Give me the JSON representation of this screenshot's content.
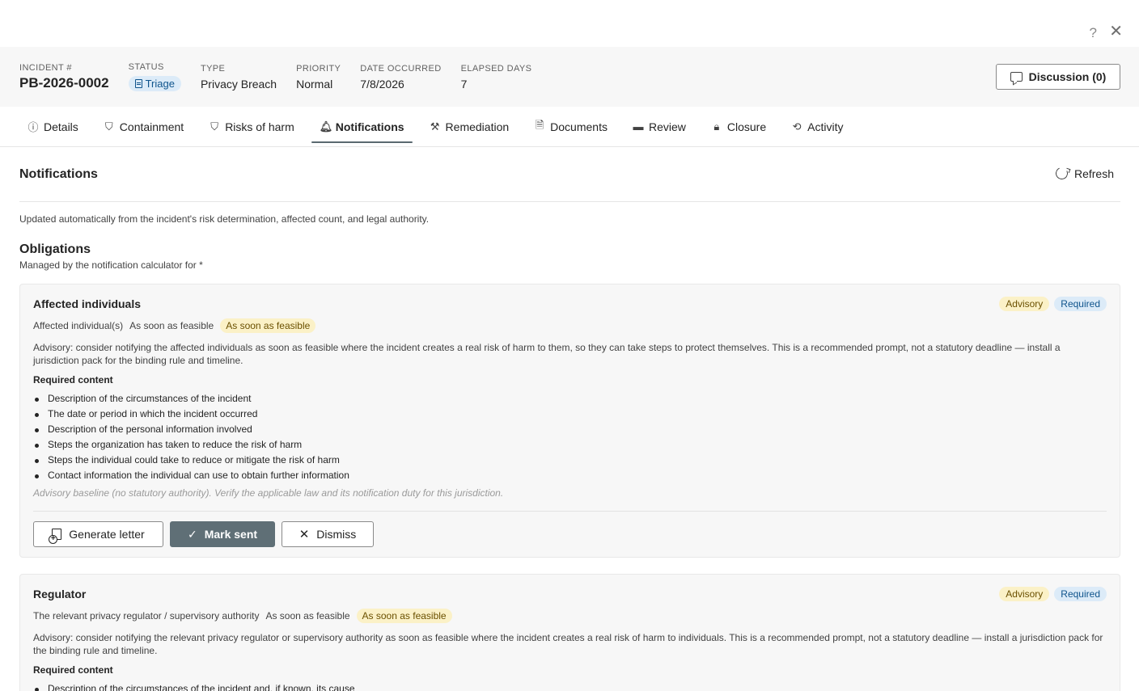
{
  "window": {
    "help_glyph": "?",
    "close_glyph": "✕"
  },
  "header": {
    "incident_label": "INCIDENT #",
    "incident_value": "PB-2026-0002",
    "status_label": "STATUS",
    "status_value": "Triage",
    "type_label": "TYPE",
    "type_value": "Privacy Breach",
    "priority_label": "PRIORITY",
    "priority_value": "Normal",
    "date_label": "DATE OCCURRED",
    "date_value": "7/8/2026",
    "elapsed_label": "ELAPSED DAYS",
    "elapsed_value": "7",
    "discussion_label": "Discussion (0)"
  },
  "tabs": [
    {
      "label": "Details",
      "icon": "info-icon",
      "glyph": "ⓘ"
    },
    {
      "label": "Containment",
      "icon": "shield-icon",
      "glyph": "⛉"
    },
    {
      "label": "Risks of harm",
      "icon": "shield-outline-icon",
      "glyph": "⛉"
    },
    {
      "label": "Notifications",
      "icon": "bell-icon",
      "glyph": "🔔︎",
      "active": true
    },
    {
      "label": "Remediation",
      "icon": "tools-icon",
      "glyph": "⚒"
    },
    {
      "label": "Documents",
      "icon": "document-icon",
      "glyph": "🗎"
    },
    {
      "label": "Review",
      "icon": "chat-icon",
      "glyph": "▬"
    },
    {
      "label": "Closure",
      "icon": "lock-icon",
      "glyph": "🔒︎"
    },
    {
      "label": "Activity",
      "icon": "history-icon",
      "glyph": "⟲"
    }
  ],
  "section": {
    "title": "Notifications",
    "refresh_label": "Refresh",
    "helper_text": "Updated automatically from the incident's risk determination, affected count, and legal authority.",
    "obligations_title": "Obligations",
    "obligations_subtitle": "Managed by the notification calculator for *"
  },
  "cards": [
    {
      "title": "Affected individuals",
      "badge_advisory": "Advisory",
      "badge_required": "Required",
      "recipient": "Affected individual(s)",
      "timing": "As soon as feasible",
      "timing_pill": "As soon as feasible",
      "description": "Advisory: consider notifying the affected individuals as soon as feasible where the incident creates a real risk of harm to them, so they can take steps to protect themselves. This is a recommended prompt, not a statutory deadline — install a jurisdiction pack for the binding rule and timeline.",
      "required_title": "Required content",
      "required_items": [
        "Description of the circumstances of the incident",
        "The date or period in which the incident occurred",
        "Description of the personal information involved",
        "Steps the organization has taken to reduce the risk of harm",
        "Steps the individual could take to reduce or mitigate the risk of harm",
        "Contact information the individual can use to obtain further information"
      ],
      "note": "Advisory baseline (no statutory authority). Verify the applicable law and its notification duty for this jurisdiction.",
      "actions": {
        "generate": "Generate letter",
        "mark_sent": "Mark sent",
        "dismiss": "Dismiss"
      }
    },
    {
      "title": "Regulator",
      "badge_advisory": "Advisory",
      "badge_required": "Required",
      "recipient": "The relevant privacy regulator / supervisory authority",
      "timing": "As soon as feasible",
      "timing_pill": "As soon as feasible",
      "description": "Advisory: consider notifying the relevant privacy regulator or supervisory authority as soon as feasible where the incident creates a real risk of harm to individuals. This is a recommended prompt, not a statutory deadline — install a jurisdiction pack for the binding rule and timeline.",
      "required_title": "Required content",
      "required_items": [
        "Description of the circumstances of the incident and, if known, its cause"
      ]
    }
  ]
}
